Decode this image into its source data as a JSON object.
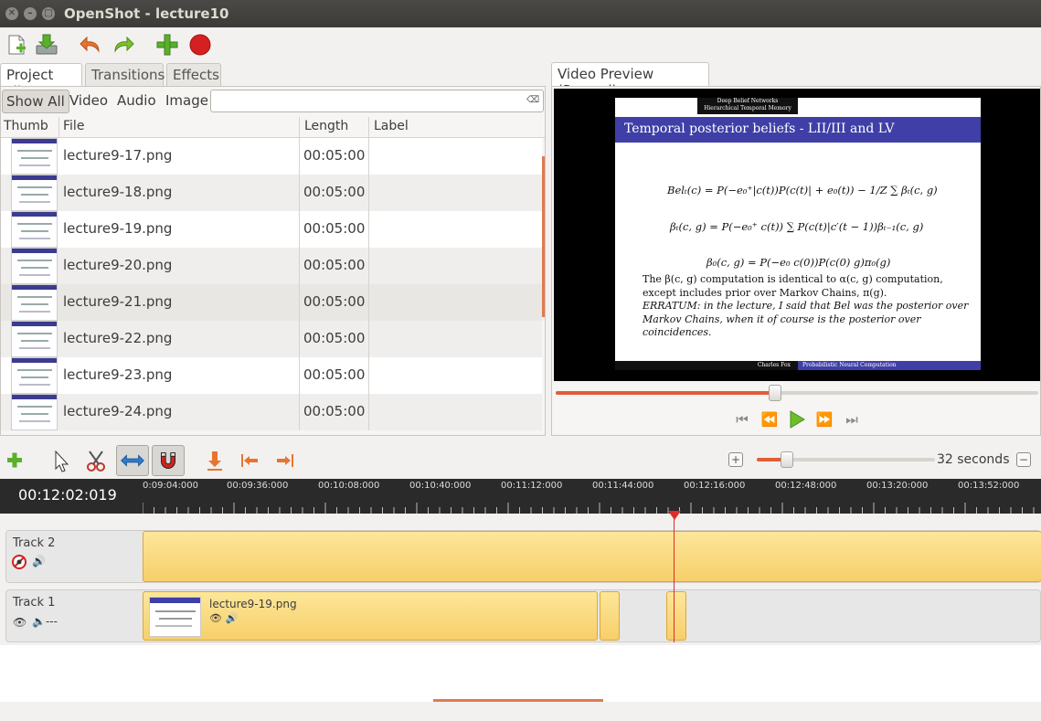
{
  "window": {
    "title": "OpenShot - lecture10"
  },
  "left_tabs": [
    "Project Files",
    "Transitions",
    "Effects"
  ],
  "filters": [
    "Show All",
    "Video",
    "Audio",
    "Image"
  ],
  "search": {
    "value": ""
  },
  "columns": {
    "thumb": "Thumb",
    "file": "File",
    "length": "Length",
    "label": "Label"
  },
  "files": [
    {
      "name": "lecture9-17.png",
      "length": "00:05:00",
      "label": ""
    },
    {
      "name": "lecture9-18.png",
      "length": "00:05:00",
      "label": ""
    },
    {
      "name": "lecture9-19.png",
      "length": "00:05:00",
      "label": ""
    },
    {
      "name": "lecture9-20.png",
      "length": "00:05:00",
      "label": ""
    },
    {
      "name": "lecture9-21.png",
      "length": "00:05:00",
      "label": ""
    },
    {
      "name": "lecture9-22.png",
      "length": "00:05:00",
      "label": ""
    },
    {
      "name": "lecture9-23.png",
      "length": "00:05:00",
      "label": ""
    },
    {
      "name": "lecture9-24.png",
      "length": "00:05:00",
      "label": ""
    }
  ],
  "preview": {
    "tab": "Video Preview (Paused)",
    "seek_fraction": 0.455,
    "slide": {
      "top_line1": "Deep Belief Networks",
      "top_line2": "Hierarchical Temporal Memory",
      "heading": "Temporal posterior beliefs - LII/III and LV",
      "eq1": "Belₜ(c) = P(−e₀⁺|c(t))P(c(t)| + e₀(t)) − 1/Z ∑ βₜ(c, g)",
      "eq2": "βₜ(c, g) = P(−e₀⁺ c(t)) ∑ P(c(t)|c′(t − 1))βₜ₋₁(c, g)",
      "eq3": "β₀(c, g) = P(−e₀ c(0))P(c(0) g)π₀(g)",
      "body_line1": "The β(c, g) computation is identical to α(c, g) computation,",
      "body_line2": "except includes prior over Markov Chains, π(g).",
      "body_line3": "ERRATUM: in the lecture, I said that Bel was the posterior over",
      "body_line4": "Markov Chains, when it of course is the posterior over coincidences.",
      "footer_left": "Charles Fox",
      "footer_right": "Probabilistic Neural Computation"
    }
  },
  "timeline": {
    "current_time": "00:12:02:019",
    "zoom_label": "32 seconds",
    "zoom_fraction": 0.17,
    "ticks": [
      "0:09:04:000",
      "00:09:36:000",
      "00:10:08:000",
      "00:10:40:000",
      "00:11:12:000",
      "00:11:44:000",
      "00:12:16:000",
      "00:12:48:000",
      "00:13:20:000",
      "00:13:52:000"
    ],
    "tracks": [
      {
        "name": "Track 2"
      },
      {
        "name": "Track 1",
        "clip_label": "lecture9-19.png"
      }
    ]
  }
}
